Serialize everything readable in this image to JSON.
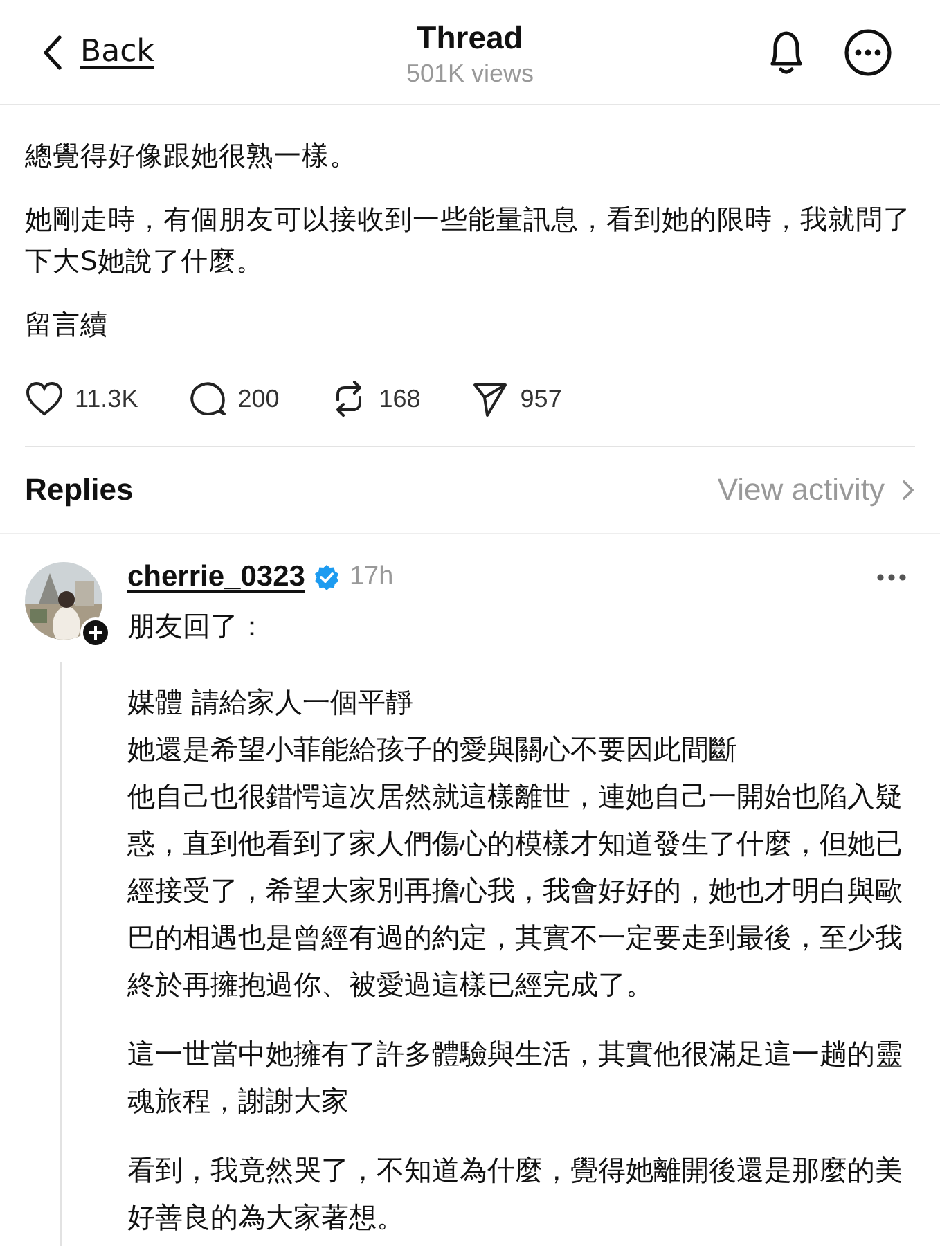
{
  "header": {
    "back_label": "Back",
    "title": "Thread",
    "views": "501K views"
  },
  "post": {
    "paragraphs": [
      "總覺得好像跟她很熟一樣。",
      "她剛走時，有個朋友可以接收到一些能量訊息，看到她的限時，我就問了下大S她說了什麼。",
      "留言續"
    ],
    "stats": [
      {
        "kind": "like",
        "count": "11.3K"
      },
      {
        "kind": "comment",
        "count": "200"
      },
      {
        "kind": "repost",
        "count": "168"
      },
      {
        "kind": "share",
        "count": "957"
      }
    ]
  },
  "replies": {
    "title": "Replies",
    "link": "View activity"
  },
  "reply": {
    "avatar": {
      "kind": "picture"
    },
    "username": "cherrie_0323",
    "verified": true,
    "time": "17h",
    "lead": "朋友回了：",
    "lines": [
      "媒體 請給家人一個平靜",
      "她還是希望小菲能給孩子的愛與關心不要因此間斷"
    ],
    "paragraphs": [
      "他自己也很錯愕這次居然就這樣離世，連她自己一開始也陷入疑惑，直到他看到了家人們傷心的模樣才知道發生了什麼，但她已經接受了，希望大家別再擔心我，我會好好的，她也才明白與歐巴的相遇也是曾經有過的約定，其實不一定要走到最後，至少我終於再擁抱過你、被愛過這樣已經完成了。",
      "這一世當中她擁有了許多體驗與生活，其實他很滿足這一趟的靈魂旅程，謝謝大家",
      "看到，我竟然哭了，不知道為什麼，覺得她離開後還是那麼的美好善良的為大家著想。"
    ]
  }
}
